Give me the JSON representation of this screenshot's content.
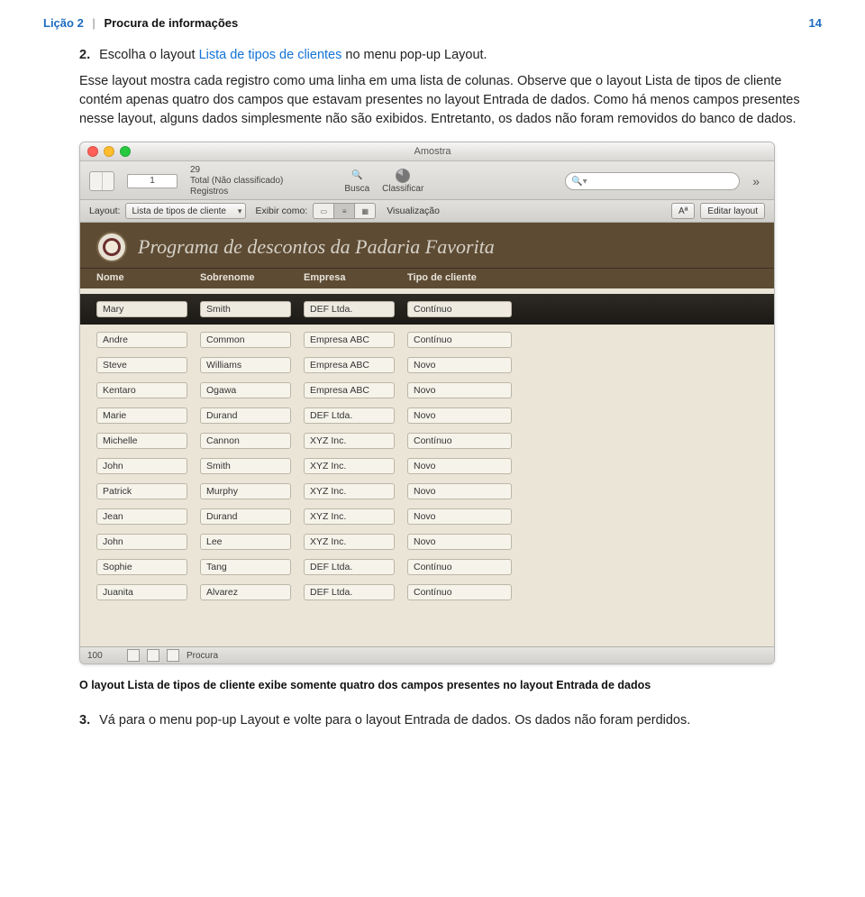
{
  "runhead": {
    "lesson": "Lição 2",
    "title": "Procura de informações",
    "pagenum": "14"
  },
  "step2": {
    "num": "2.",
    "sentence_a": "Escolha o layout ",
    "layout_name": "Lista de tipos de clientes",
    "sentence_b": " no menu pop-up Layout.",
    "para": "Esse layout mostra cada registro como uma linha em uma lista de colunas. Observe que o layout Lista de tipos de cliente contém apenas quatro dos campos que estavam presentes no layout Entrada de dados. Como há menos campos presentes nesse layout, alguns dados simplesmente não são exibidos. Entretanto, os dados não foram removidos do banco de dados."
  },
  "window": {
    "title": "Amostra",
    "record_current": "1",
    "record_total": "29",
    "record_sub": "Total (Não classificado)",
    "lbl_registros": "Registros",
    "lbl_busca": "Busca",
    "lbl_classificar": "Classificar",
    "search_ph": "",
    "tb2": {
      "layout_lbl": "Layout:",
      "layout_val": "Lista de tipos de cliente",
      "exibir_lbl": "Exibir como:",
      "visualizacao": "Visualização",
      "aa": "Aª",
      "editar": "Editar layout"
    },
    "banner_title": "Programa de descontos da Padaria Favorita",
    "cols": {
      "c1": "Nome",
      "c2": "Sobrenome",
      "c3": "Empresa",
      "c4": "Tipo de cliente"
    },
    "rows": [
      {
        "c1": "Mary",
        "c2": "Smith",
        "c3": "DEF Ltda.",
        "c4": "Contínuo"
      },
      {
        "c1": "Andre",
        "c2": "Common",
        "c3": "Empresa ABC",
        "c4": "Contínuo"
      },
      {
        "c1": "Steve",
        "c2": "Williams",
        "c3": "Empresa ABC",
        "c4": "Novo"
      },
      {
        "c1": "Kentaro",
        "c2": "Ogawa",
        "c3": "Empresa ABC",
        "c4": "Novo"
      },
      {
        "c1": "Marie",
        "c2": "Durand",
        "c3": "DEF Ltda.",
        "c4": "Novo"
      },
      {
        "c1": "Michelle",
        "c2": "Cannon",
        "c3": "XYZ Inc.",
        "c4": "Contínuo"
      },
      {
        "c1": "John",
        "c2": "Smith",
        "c3": "XYZ Inc.",
        "c4": "Novo"
      },
      {
        "c1": "Patrick",
        "c2": "Murphy",
        "c3": "XYZ Inc.",
        "c4": "Novo"
      },
      {
        "c1": "Jean",
        "c2": "Durand",
        "c3": "XYZ Inc.",
        "c4": "Novo"
      },
      {
        "c1": "John",
        "c2": "Lee",
        "c3": "XYZ Inc.",
        "c4": "Novo"
      },
      {
        "c1": "Sophie",
        "c2": "Tang",
        "c3": "DEF Ltda.",
        "c4": "Contínuo"
      },
      {
        "c1": "Juanita",
        "c2": "Alvarez",
        "c3": "DEF Ltda.",
        "c4": "Contínuo"
      }
    ],
    "status": {
      "zoom": "100",
      "mode": "Procura"
    }
  },
  "caption": "O layout Lista de tipos de cliente exibe somente quatro dos campos presentes no layout Entrada de dados",
  "step3": {
    "num": "3.",
    "text": "Vá para o menu pop-up Layout e volte para o layout Entrada de dados. Os dados não foram perdidos."
  }
}
